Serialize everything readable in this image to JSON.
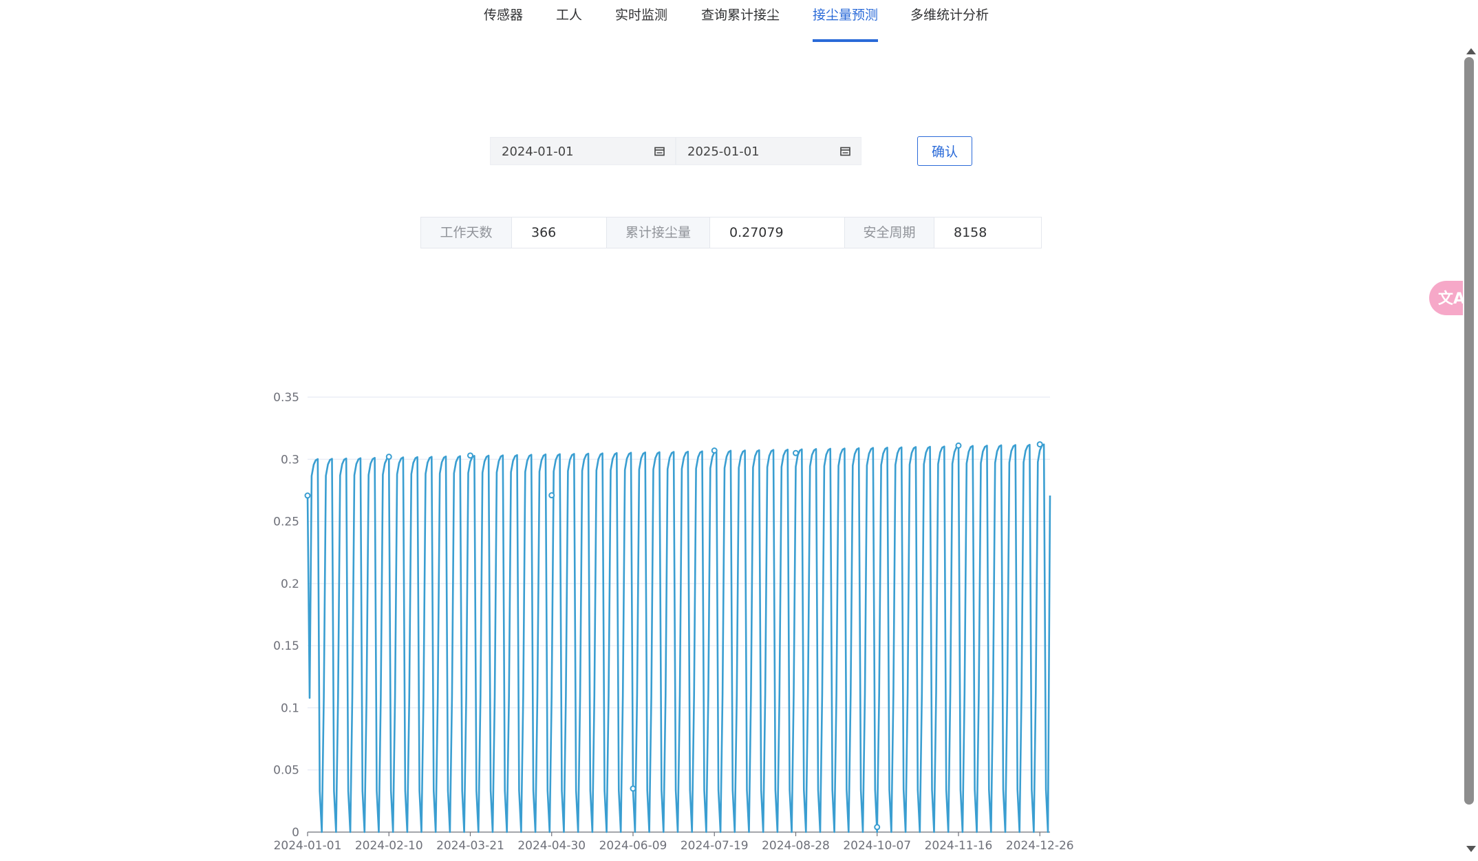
{
  "nav": {
    "tabs": [
      {
        "label": "传感器",
        "active": false
      },
      {
        "label": "工人",
        "active": false
      },
      {
        "label": "实时监测",
        "active": false
      },
      {
        "label": "查询累计接尘",
        "active": false
      },
      {
        "label": "接尘量预测",
        "active": true
      },
      {
        "label": "多维统计分析",
        "active": false
      }
    ]
  },
  "filters": {
    "start_date": "2024-01-01",
    "end_date": "2025-01-01",
    "confirm_label": "确认"
  },
  "stats": {
    "work_days_label": "工作天数",
    "work_days_value": "366",
    "cumulative_label": "累计接尘量",
    "cumulative_value": "0.27079",
    "safety_label": "安全周期",
    "safety_value": "8158"
  },
  "translate": {
    "glyph": "文A",
    "icon": "translate-icon"
  },
  "colors": {
    "accent": "#2a6ad8",
    "series": "#3a9ed1",
    "translate_bg": "#f6a8c8"
  },
  "chart_data": {
    "type": "line",
    "title": "",
    "xlabel": "",
    "ylabel": "",
    "ylim": [
      0,
      0.35
    ],
    "yticks": [
      "0",
      "0.05",
      "0.1",
      "0.15",
      "0.2",
      "0.25",
      "0.3",
      "0.35"
    ],
    "xlim": [
      "2024-01-01",
      "2024-12-31"
    ],
    "xticks": [
      "2024-01-01",
      "2024-02-10",
      "2024-03-21",
      "2024-04-30",
      "2024-06-09",
      "2024-07-19",
      "2024-08-28",
      "2024-10-07",
      "2024-11-16",
      "2024-12-26"
    ],
    "grid": true,
    "legend": "none",
    "series": [
      {
        "pattern": "weekly sawtooth: rises from 0 to a plateau over ~5 days, then drops to 0 for ~2 days",
        "plateau_start": 0.3,
        "plateau_end": 0.312,
        "first_value": 0.27079,
        "last_value": 0.27079,
        "markers": [
          {
            "x": "2024-01-01",
            "y": 0.2708
          },
          {
            "x": "2024-02-10",
            "y": 0.302
          },
          {
            "x": "2024-03-21",
            "y": 0.303
          },
          {
            "x": "2024-04-30",
            "y": 0.271
          },
          {
            "x": "2024-06-09",
            "y": 0.035
          },
          {
            "x": "2024-07-19",
            "y": 0.307
          },
          {
            "x": "2024-08-28",
            "y": 0.305
          },
          {
            "x": "2024-10-07",
            "y": 0.004
          },
          {
            "x": "2024-11-16",
            "y": 0.311
          },
          {
            "x": "2024-12-26",
            "y": 0.312
          }
        ]
      }
    ]
  }
}
